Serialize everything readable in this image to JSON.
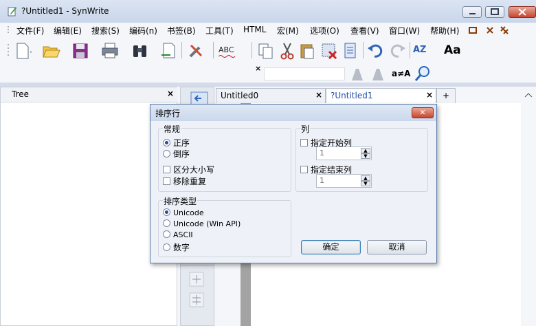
{
  "window": {
    "title": "?Untitled1 - SynWrite"
  },
  "menu": [
    "文件(F)",
    "编辑(E)",
    "搜索(S)",
    "编码(n)",
    "书签(B)",
    "工具(T)",
    "HTML",
    "宏(M)",
    "选项(O)",
    "查看(V)",
    "窗口(W)",
    "帮助(H)"
  ],
  "toolbar": {
    "spell_label": "ABC",
    "case_label": "a≠A",
    "font_label": "Aa",
    "sort_label": "AZ"
  },
  "tree": {
    "title": "Tree",
    "close": "×"
  },
  "tabs": [
    {
      "label": "Untitled0",
      "close": "×"
    },
    {
      "label": "?Untitled1",
      "close": "×"
    },
    {
      "label": "+"
    }
  ],
  "dialog": {
    "title": "排序行",
    "close": "✕",
    "general": {
      "label": "常规",
      "ascending": "正序",
      "descending": "倒序",
      "case_sensitive": "区分大小写",
      "remove_duplicates": "移除重复"
    },
    "columns": {
      "label": "列",
      "start_col_label": "指定开始列",
      "start_col_value": "1",
      "end_col_label": "指定结束列",
      "end_col_value": "1"
    },
    "sort_type": {
      "label": "排序类型",
      "unicode": "Unicode",
      "unicode_winapi": "Unicode (Win API)",
      "ascii": "ASCII",
      "numeric": "数字"
    },
    "ok": "确定",
    "cancel": "取消"
  }
}
